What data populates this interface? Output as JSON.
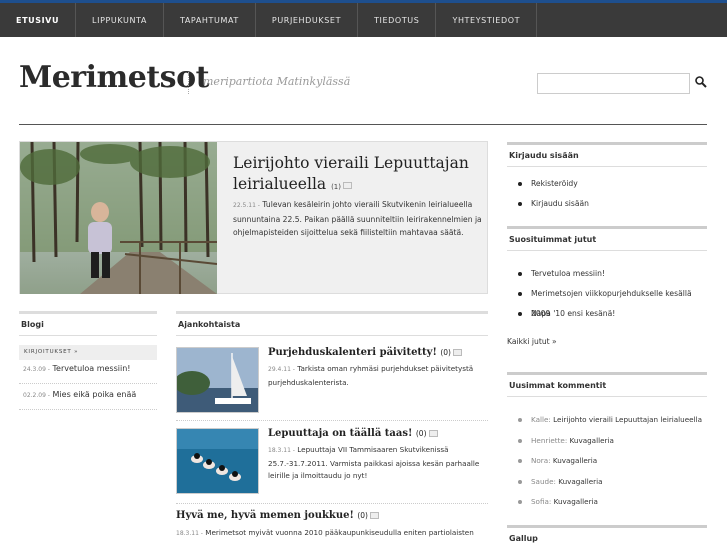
{
  "nav": {
    "items": [
      "ETUSIVU",
      "LIPPUKUNTA",
      "TAPAHTUMAT",
      "PURJEHDUKSET",
      "TIEDOTUS",
      "YHTEYSTIEDOT"
    ]
  },
  "header": {
    "title": "Merimetsot",
    "tagline": "meripartiota Matinkylässä",
    "search_placeholder": ""
  },
  "feature": {
    "title": "Leirijohto vieraili Lepuuttajan leirialueella",
    "comments": "(1)",
    "date": "22.5.11 -",
    "text": "Tulevan kesäleirin johto vieraili Skutvikenin leirialueella sunnuntaina 22.5. Paikan päällä suunniteltiin leirirakennelmien ja ohjelmapisteiden sijoittelua sekä fiilisteltiin mahtavaa säätä."
  },
  "blog": {
    "heading": "Blogi",
    "category": "KIRJOITUKSET »",
    "items": [
      {
        "date": "24.3.09 -",
        "title": "Tervetuloa messiin!"
      },
      {
        "date": "02.2.09 -",
        "title": "Mies eikä poika enää"
      }
    ]
  },
  "news": {
    "heading": "Ajankohtaista",
    "items": [
      {
        "title": "Purjehduskalenteri päivitetty!",
        "comments": "(0)",
        "date": "29.4.11 -",
        "text": "Tarkista oman ryhmäsi purjehdukset päivitetystä purjehduskalenterista."
      },
      {
        "title": "Lepuuttaja on täällä taas!",
        "comments": "(0)",
        "date": "18.3.11 -",
        "text": "Lepuuttaja VII Tammisaaren Skutvikenissä 25.7.-31.7.2011. Varmista paikkasi ajoissa kesän parhaalle leirille ja ilmoittaudu jo nyt!"
      },
      {
        "title": "Hyvä me, hyvä memen joukkue!",
        "comments": "(0)",
        "date": "18.3.11 -",
        "text": "Merimetsot myivät vuonna 2010 pääkaupunkiseudulla eniten partiolaisten"
      }
    ]
  },
  "sidebar": {
    "login_heading": "Kirjaudu sisään",
    "login_items": [
      "Rekisteröidy",
      "Kirjaudu sisään"
    ],
    "popular_heading": "Suosituimmat jutut",
    "popular_items": [
      "Tervetuloa messiin!",
      "Merimetsojen viikkopurjehdukselle kesällä 2009",
      "Napa '10 ensi kesänä!"
    ],
    "all_link": "Kaikki jutut »",
    "comments_heading": "Uusimmat kommentit",
    "comments": [
      {
        "author": "Kalle:",
        "target": "Leirijohto vieraili Lepuuttajan leirialueella"
      },
      {
        "author": "Henriette:",
        "target": "Kuvagalleria"
      },
      {
        "author": "Nora:",
        "target": "Kuvagalleria"
      },
      {
        "author": "Saude:",
        "target": "Kuvagalleria"
      },
      {
        "author": "Sofia:",
        "target": "Kuvagalleria"
      }
    ],
    "gallup_heading": "Gallup"
  },
  "colors": {
    "nav_bg": "#3a3a3a",
    "nav_accent": "#1e4f8e",
    "feature_bg": "#f0f0f0"
  }
}
